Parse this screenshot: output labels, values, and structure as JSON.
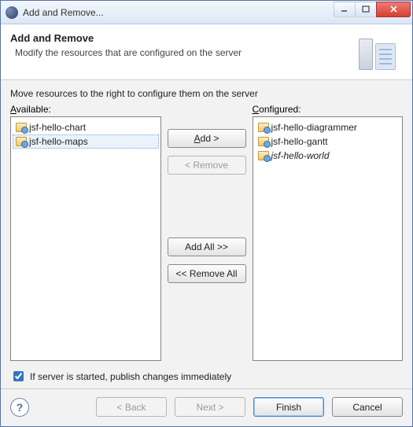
{
  "window": {
    "title": "Add and Remove..."
  },
  "banner": {
    "title": "Add and Remove",
    "subtitle": "Modify the resources that are configured on the server"
  },
  "instructions": "Move resources to the right to configure them on the server",
  "labels": {
    "available_pre": "A",
    "available_post": "vailable:",
    "configured_pre": "C",
    "configured_post": "onfigured:"
  },
  "available": [
    {
      "name": "jsf-hello-chart",
      "selected": false
    },
    {
      "name": "jsf-hello-maps",
      "selected": true
    }
  ],
  "configured": [
    {
      "name": "jsf-hello-diagrammer",
      "italic": false
    },
    {
      "name": "jsf-hello-gantt",
      "italic": false
    },
    {
      "name": "jsf-hello-world",
      "italic": true
    }
  ],
  "buttons": {
    "add_pre": "A",
    "add_post": "dd >",
    "remove": "< Remove",
    "addall": "Add All >>",
    "removeall": "<< Remove All"
  },
  "checkbox": {
    "checked": true,
    "label": "If server is started, publish changes immediately"
  },
  "footer": {
    "back": "< Back",
    "next": "Next >",
    "finish": "Finish",
    "cancel": "Cancel"
  }
}
